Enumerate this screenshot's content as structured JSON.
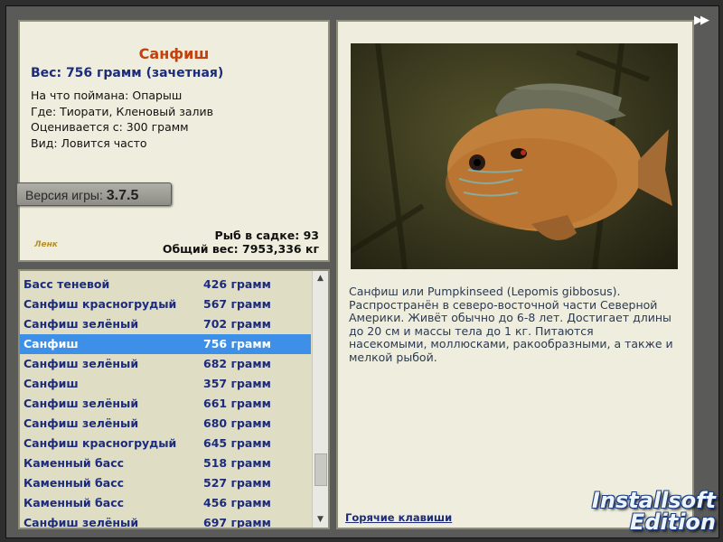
{
  "info": {
    "title": "Санфиш",
    "weight": "Вес: 756 грамм (зачетная)",
    "lines": [
      "На что поймана: Опарыш",
      "Где: Тиорати, Кленовый залив",
      "Оценивается с: 300 грамм",
      "Вид: Ловится часто"
    ],
    "version_label": "Версия игры:",
    "version_number": "3.7.5",
    "logo_small": "Ленк",
    "fish_count": "Рыб в садке: 93",
    "total_weight": "Общий вес: 7953,336 кг"
  },
  "list": {
    "selected_index": 3,
    "rows": [
      {
        "name": "Басс теневой",
        "weight": "426 грамм"
      },
      {
        "name": "Санфиш красногрудый",
        "weight": "567 грамм"
      },
      {
        "name": "Санфиш зелёный",
        "weight": "702 грамм"
      },
      {
        "name": "Санфиш",
        "weight": "756 грамм"
      },
      {
        "name": "Санфиш зелёный",
        "weight": "682 грамм"
      },
      {
        "name": "Санфиш",
        "weight": "357 грамм"
      },
      {
        "name": "Санфиш зелёный",
        "weight": "661 грамм"
      },
      {
        "name": "Санфиш зелёный",
        "weight": "680 грамм"
      },
      {
        "name": "Санфиш красногрудый",
        "weight": "645 грамм"
      },
      {
        "name": "Каменный басс",
        "weight": "518 грамм"
      },
      {
        "name": "Каменный басс",
        "weight": "527 грамм"
      },
      {
        "name": "Каменный басс",
        "weight": "456 грамм"
      },
      {
        "name": "Санфиш зелёный",
        "weight": "697 грамм"
      }
    ]
  },
  "photo": {
    "description": "Санфиш или Pumpkinseed (Lepomis gibbosus). Распространён в северо-восточной части Северной Америки. Живёт обычно до 6-8 лет. Достигает длины до 20 см и массы тела до 1 кг. Питаются насекомыми, моллюсками, ракообразными, а также и мелкой рыбой.",
    "hotkeys_link": "Горячие клавиши"
  },
  "brand": {
    "line1": "Installsoft",
    "line2": "Edition"
  },
  "icons": {
    "forward": "fast-forward-icon",
    "scroll_up": "scroll-up-arrow-icon",
    "scroll_down": "scroll-down-arrow-icon"
  },
  "colors": {
    "title": "#c4400c",
    "link": "#1c2b7c",
    "selection": "#3d8fe8",
    "panel": "#efeede"
  }
}
